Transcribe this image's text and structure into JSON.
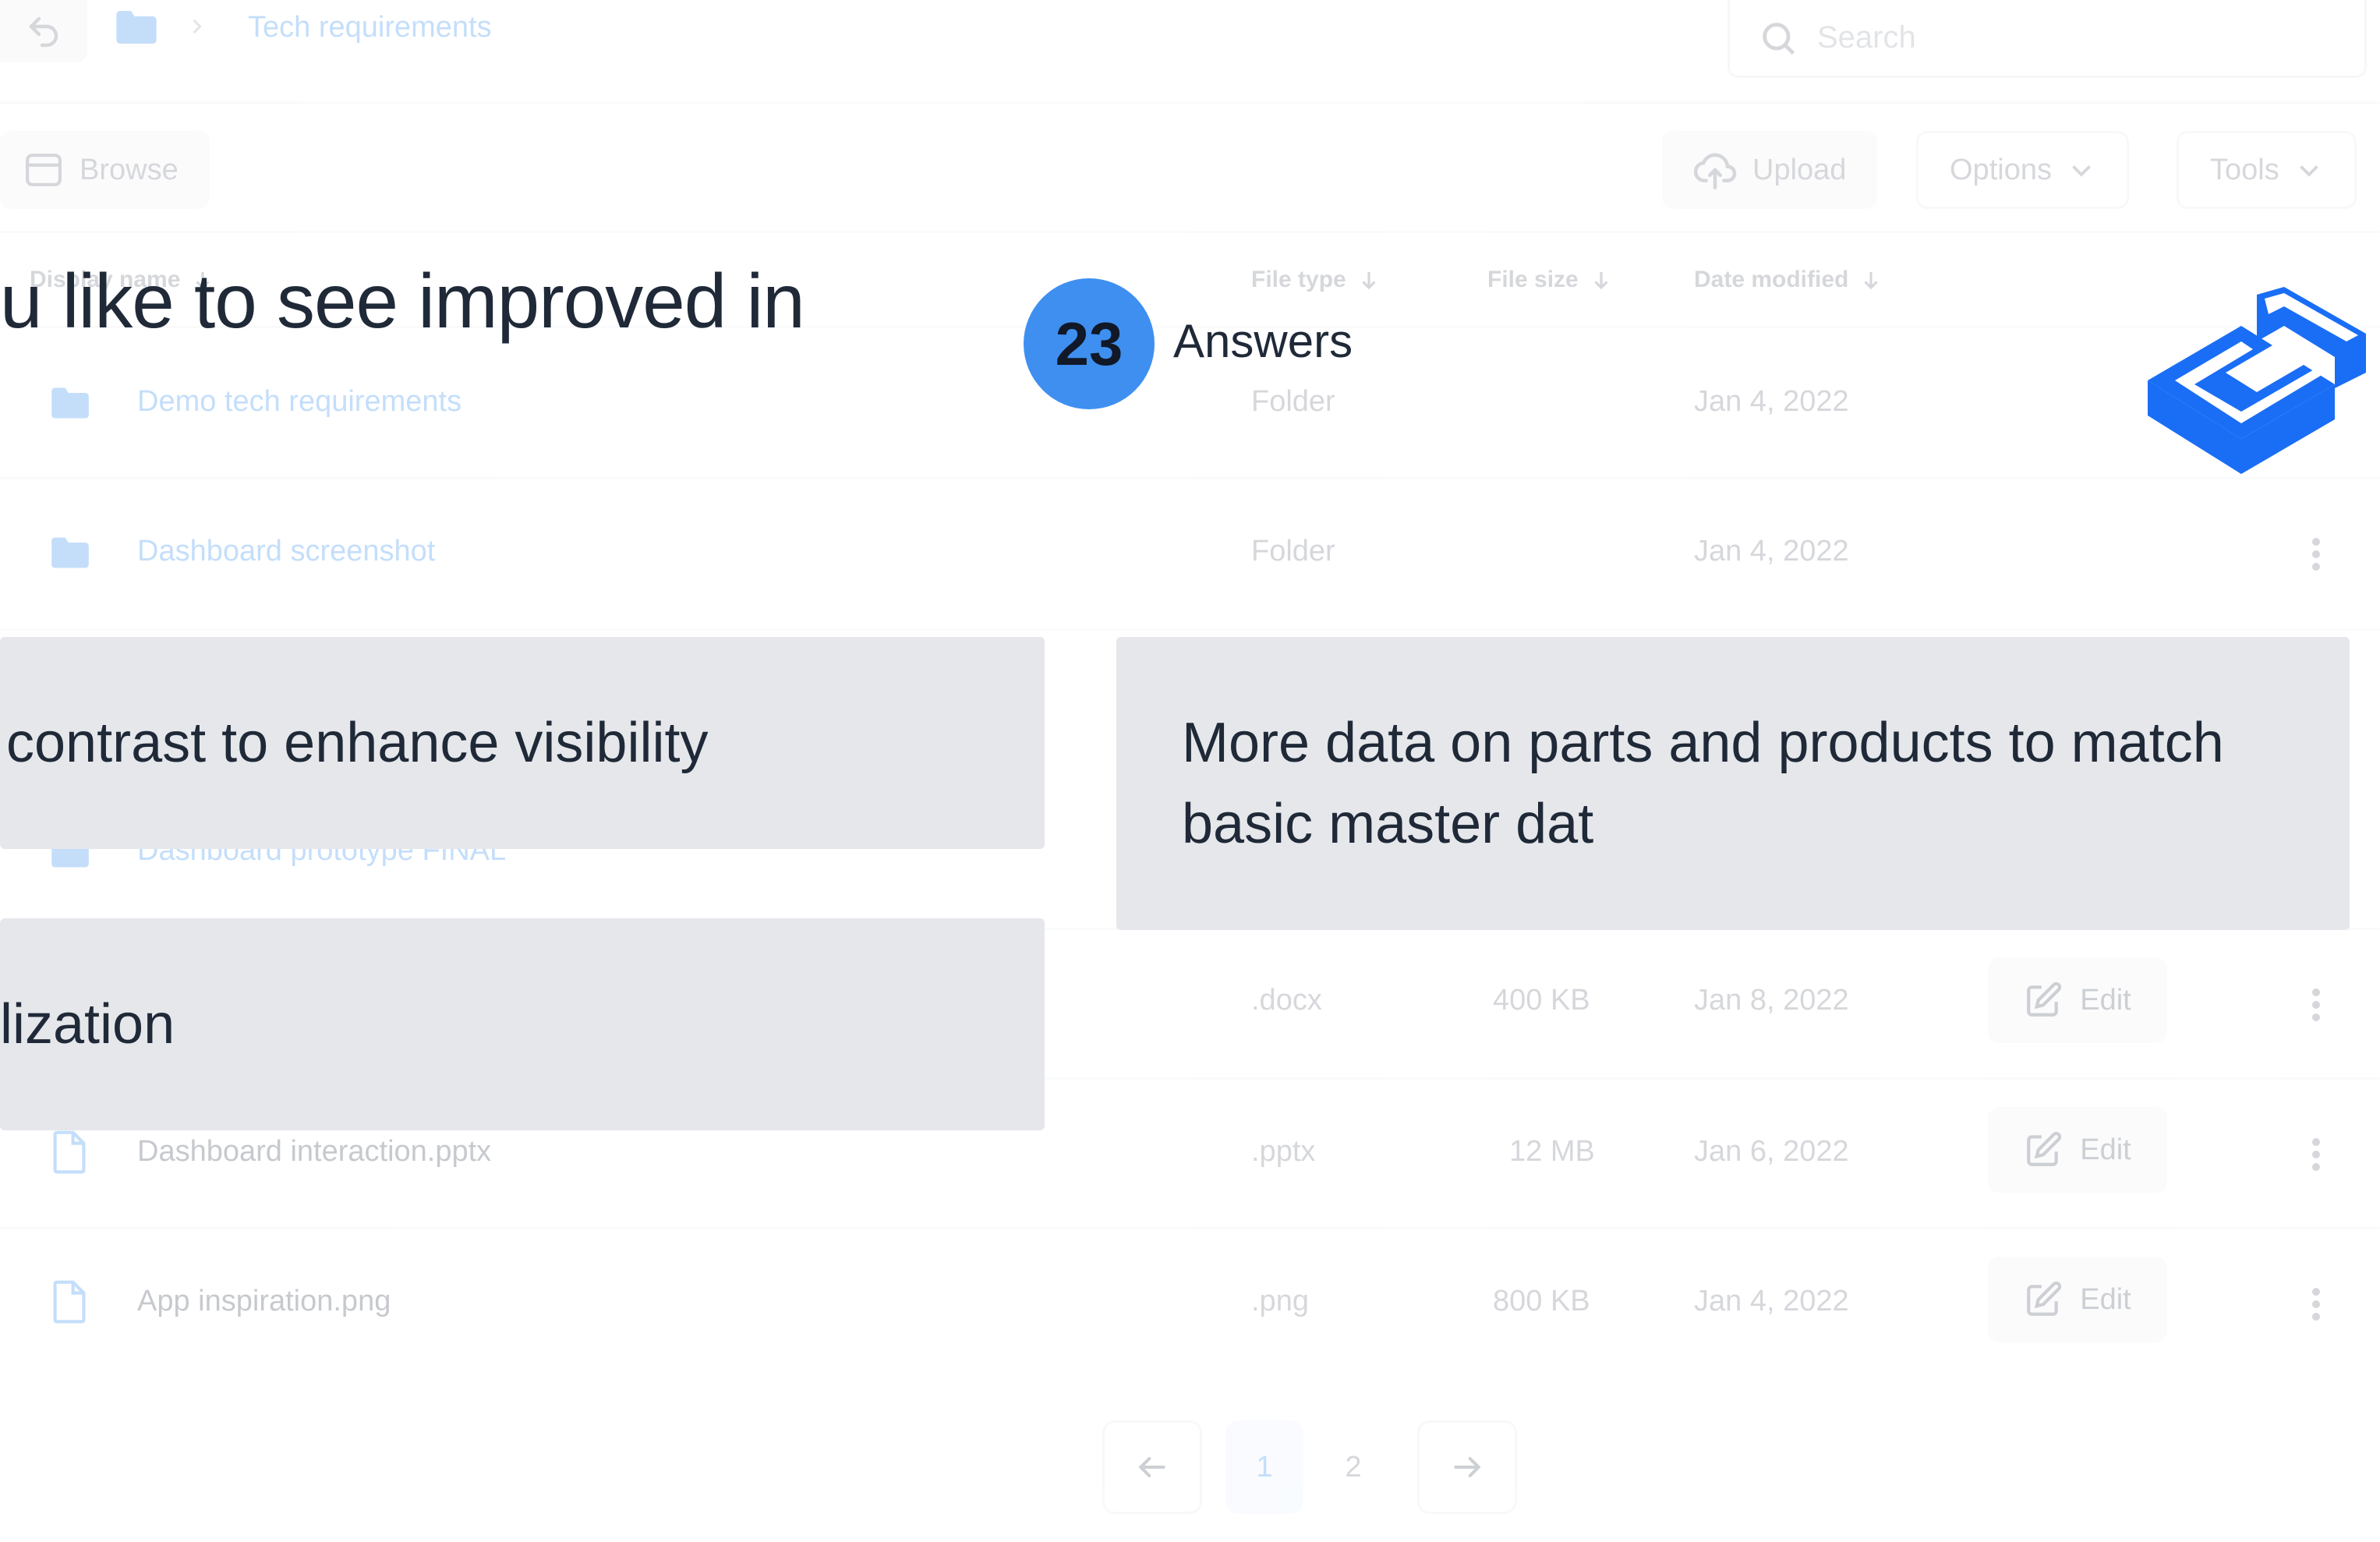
{
  "breadcrumb": {
    "current": "Tech requirements"
  },
  "search": {
    "placeholder": "Search"
  },
  "toolbar": {
    "browse": "Browse",
    "upload": "Upload",
    "options": "Options",
    "tools": "Tools"
  },
  "table": {
    "headers": {
      "name": "Display name",
      "type": "File type",
      "size": "File size",
      "date": "Date modified"
    },
    "rows": [
      {
        "name": "Demo tech requirements",
        "type": "Folder",
        "size": "",
        "date": "Jan 4, 2022"
      },
      {
        "name": "Dashboard screenshot",
        "type": "Folder",
        "size": "",
        "date": "Jan 4, 2022"
      },
      {
        "name": "Dashboard prototype FINAL",
        "type": "",
        "size": "",
        "date": ""
      },
      {
        "name": "",
        "type": ".docx",
        "size": "400 KB",
        "date": "Jan 8, 2022",
        "action": "Edit"
      },
      {
        "name": "Dashboard interaction.pptx",
        "type": ".pptx",
        "size": "12 MB",
        "date": "Jan 6, 2022",
        "action": "Edit"
      },
      {
        "name": "App inspiration.png",
        "type": ".png",
        "size": "800 KB",
        "date": "Jan 4, 2022",
        "action": "Edit"
      }
    ]
  },
  "pagination": {
    "prev": "←",
    "pages": [
      "1",
      "2"
    ],
    "next": "→"
  },
  "overlay": {
    "question": "u like to see improved in",
    "answers_count": "23",
    "answers_label": "Answers",
    "cards": [
      "contrast to enhance visibility",
      "More data on parts and products to match basic master dat",
      "lization"
    ]
  },
  "colors": {
    "accent": "#3e8ff0",
    "logo": "#1a6ef5",
    "card_bg": "#e5e7eb"
  },
  "icons": [
    "back-arrow-icon",
    "folder-icon",
    "chevron-right-icon",
    "search-icon",
    "browse-icon",
    "upload-cloud-icon",
    "chevron-down-icon",
    "sort-down-icon",
    "file-icon",
    "edit-icon",
    "kebab-menu-icon",
    "arrow-left-icon",
    "arrow-right-icon",
    "brand-logo"
  ]
}
